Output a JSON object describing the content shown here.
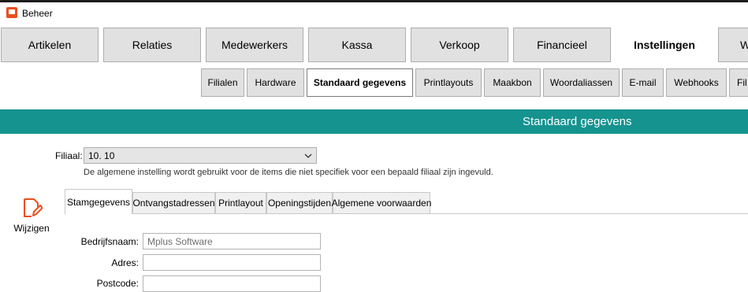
{
  "window": {
    "title": "Beheer"
  },
  "main_tabs": [
    {
      "label": "Artikelen"
    },
    {
      "label": "Relaties"
    },
    {
      "label": "Medewerkers"
    },
    {
      "label": "Kassa"
    },
    {
      "label": "Verkoop"
    },
    {
      "label": "Financieel"
    },
    {
      "label": "Instellingen",
      "active": true
    },
    {
      "label": "W"
    }
  ],
  "sub_tabs": [
    {
      "label": "Filialen"
    },
    {
      "label": "Hardware"
    },
    {
      "label": "Standaard gegevens",
      "active": true
    },
    {
      "label": "Printlayouts"
    },
    {
      "label": "Maakbon"
    },
    {
      "label": "Woordaliassen"
    },
    {
      "label": "E-mail"
    },
    {
      "label": "Webhooks"
    },
    {
      "label": "Fil"
    }
  ],
  "section": {
    "title": "Standaard gegevens"
  },
  "filiaal": {
    "label": "Filiaal:",
    "selected": "10. 10",
    "hint": "De algemene instelling wordt gebruikt voor de items die niet specifiek voor een bepaald filiaal zijn ingevuld."
  },
  "edit_button": {
    "label": "Wijzigen",
    "icon": "pencil-edit-icon"
  },
  "inner_tabs": [
    {
      "label": "Stamgegevens",
      "active": true
    },
    {
      "label": "Ontvangstadressen"
    },
    {
      "label": "Printlayout"
    },
    {
      "label": "Openingstijden"
    },
    {
      "label": "Algemene voorwaarden"
    }
  ],
  "form": {
    "company_label": "Bedrijfsnaam:",
    "company_value": "Mplus Software",
    "address_label": "Adres:",
    "address_value": "",
    "postcode_label": "Postcode:",
    "postcode_value": ""
  },
  "colors": {
    "header_teal": "#15938f",
    "icon_orange": "#e8501f",
    "tab_grey": "#e1e1e1"
  }
}
